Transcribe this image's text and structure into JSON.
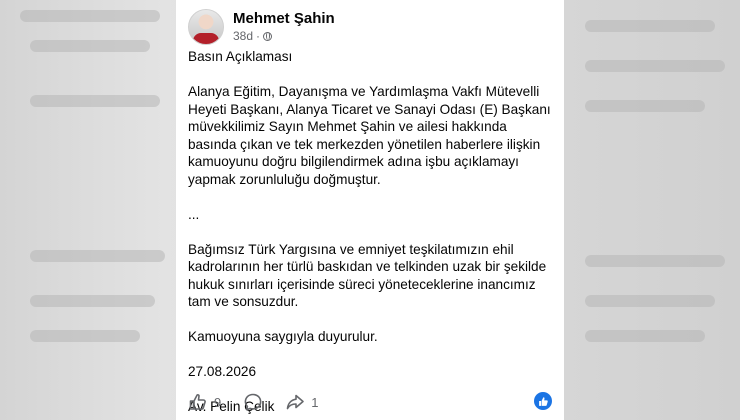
{
  "post": {
    "author": "Mehmet Şahin",
    "time": "38d",
    "separator": "·",
    "body": {
      "title": "Basın Açıklaması",
      "paragraph1": "Alanya Eğitim, Dayanışma ve Yardımlaşma Vakfı Mütevelli Heyeti Başkanı, Alanya Ticaret ve Sanayi Odası (E) Başkanı müvekkilimiz Sayın Mehmet Şahin ve ailesi hakkında basında çıkan ve tek merkezden yönetilen haberlere ilişkin kamuoyunu doğru bilgilendirmek adına işbu açıklamayı yapmak zorunluluğu doğmuştur.",
      "ellipsis": "...",
      "paragraph2": "Bağımsız Türk Yargısına ve emniyet teşkilatımızın ehil kadrolarının her türlü baskıdan ve telkinden uzak bir şekilde hukuk sınırları içerisinde süreci yöneteceklerine inancımız tam ve sonsuzdur.",
      "closing": "Kamuoyuna saygıyla duyurulur.",
      "date": "27.08.2026",
      "signature": "Av. Pelin Çelik"
    },
    "actions": {
      "like_count": "9",
      "share_count": "1"
    }
  },
  "icons": {
    "privacy": "globe-icon",
    "like": "thumbs-up-icon",
    "comment": "comment-bubble-icon",
    "share": "share-arrow-icon",
    "reaction": "like-reaction-icon"
  },
  "colors": {
    "background": "#d9d9d9",
    "card": "#ffffff",
    "text": "#050505",
    "secondary_text": "#65676b",
    "accent": "#1b74e4"
  }
}
